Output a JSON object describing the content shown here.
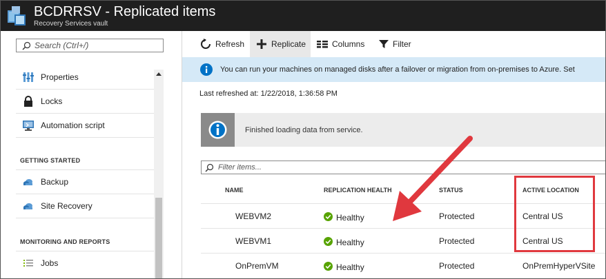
{
  "header": {
    "title": "BCDRRSV - Replicated items",
    "subtitle": "Recovery Services vault"
  },
  "sidebar": {
    "search_placeholder": "Search (Ctrl+/)",
    "items": [
      {
        "label": "Properties",
        "icon": "properties-icon"
      },
      {
        "label": "Locks",
        "icon": "lock-icon"
      },
      {
        "label": "Automation script",
        "icon": "automation-script-icon"
      }
    ],
    "sections": [
      {
        "title": "GETTING STARTED",
        "items": [
          {
            "label": "Backup",
            "icon": "cloud-backup-icon"
          },
          {
            "label": "Site Recovery",
            "icon": "cloud-site-recovery-icon"
          }
        ]
      },
      {
        "title": "MONITORING AND REPORTS",
        "items": [
          {
            "label": "Jobs",
            "icon": "jobs-list-icon"
          }
        ]
      }
    ]
  },
  "toolbar": {
    "refresh": "Refresh",
    "replicate": "Replicate",
    "columns": "Columns",
    "filter": "Filter"
  },
  "banner": {
    "text": "You can run your machines on managed disks after a failover or migration from on-premises to Azure. Set"
  },
  "last_refreshed": "Last refreshed at: 1/22/2018, 1:36:58 PM",
  "notice": {
    "text": "Finished loading data from service."
  },
  "filter": {
    "placeholder": "Filter items..."
  },
  "table": {
    "columns": [
      "NAME",
      "REPLICATION HEALTH",
      "STATUS",
      "ACTIVE LOCATION"
    ],
    "rows": [
      {
        "name": "WEBVM2",
        "health": "Healthy",
        "status": "Protected",
        "location": "Central US"
      },
      {
        "name": "WEBVM1",
        "health": "Healthy",
        "status": "Protected",
        "location": "Central US"
      },
      {
        "name": "OnPremVM",
        "health": "Healthy",
        "status": "Protected",
        "location": "OnPremHyperVSite"
      }
    ]
  },
  "colors": {
    "header_bg": "#1f1f1f",
    "banner_bg": "#d5e9f7",
    "info_blue": "#0072c6",
    "healthy_green": "#57a300",
    "annotation_red": "#e0383e"
  }
}
